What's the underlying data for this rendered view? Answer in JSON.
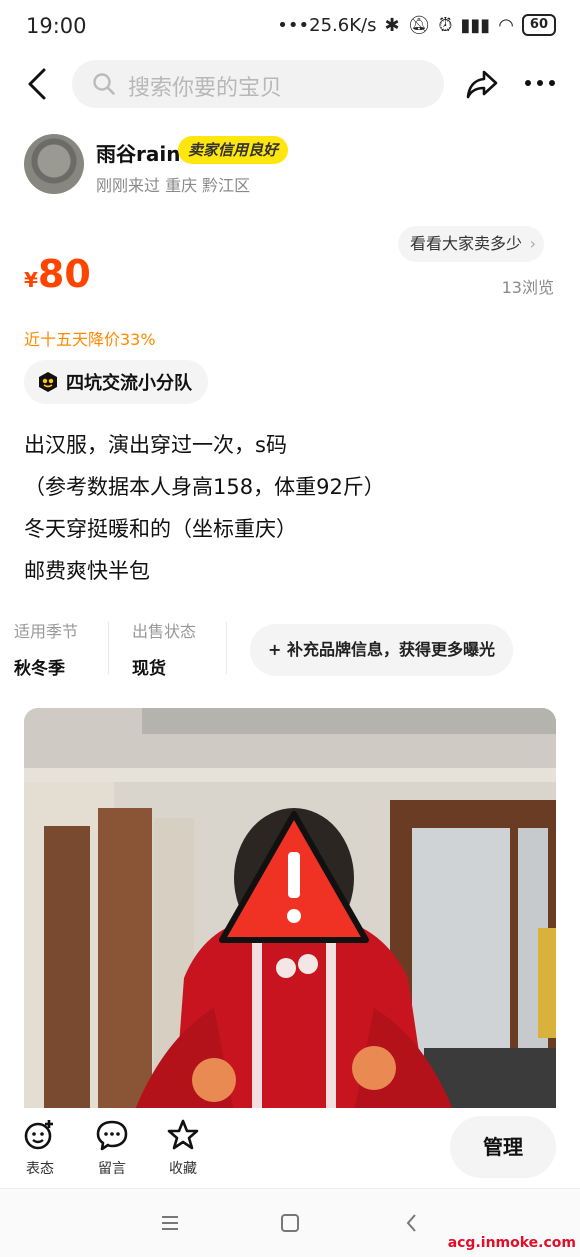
{
  "status_bar": {
    "time": "19:00",
    "network_speed": "25.6K/s",
    "battery": "60"
  },
  "top_bar": {
    "search_placeholder": "搜索你要的宝贝"
  },
  "seller": {
    "name": "雨谷rain",
    "credit_badge": "卖家信用良好",
    "meta": "刚刚来过 重庆 黔江区"
  },
  "price": {
    "symbol": "¥",
    "amount": "80",
    "compare_label": "看看大家卖多少",
    "views": "13浏览",
    "drop_note": "近十五天降价33%"
  },
  "tag": {
    "label": "四坑交流小分队"
  },
  "description": {
    "lines": [
      "出汉服，演出穿过一次，s码",
      "（参考数据本人身高158，体重92斤）",
      "冬天穿挺暖和的（坐标重庆）",
      "邮费爽快半包"
    ]
  },
  "attributes": {
    "season_key": "适用季节",
    "season_value": "秋冬季",
    "status_key": "出售状态",
    "status_value": "现货",
    "brand_button": "+ 补充品牌信息，获得更多曝光"
  },
  "bottom_bar": {
    "react_label": "表态",
    "comment_label": "留言",
    "favorite_label": "收藏",
    "manage_label": "管理"
  },
  "watermark": "acg.inmoke.com",
  "colors": {
    "price": "#ff4400",
    "price_drop": "#ff8a00",
    "badge": "#ffe60f",
    "chip_bg": "#f4f4f4"
  }
}
